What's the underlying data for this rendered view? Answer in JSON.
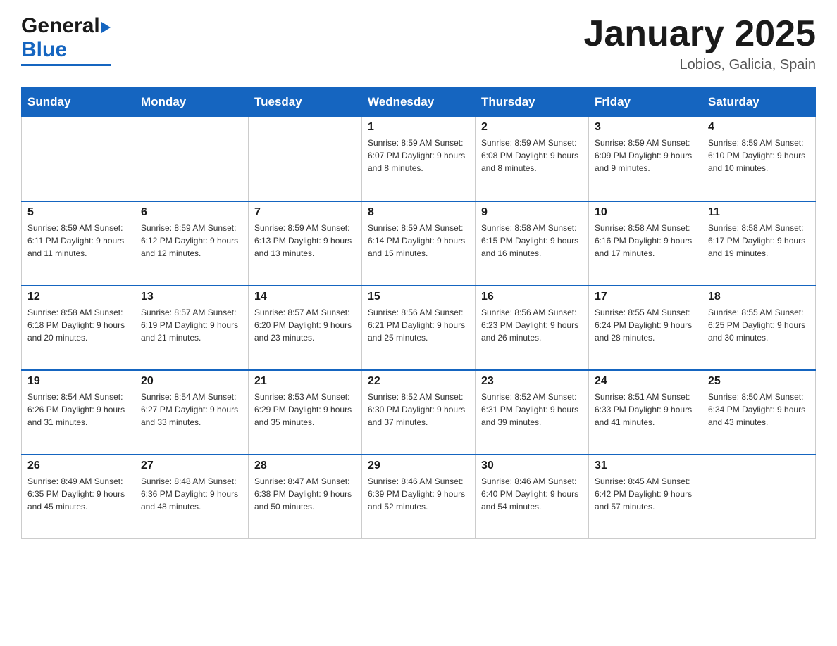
{
  "header": {
    "logo_general": "General",
    "logo_blue": "Blue",
    "month_title": "January 2025",
    "location": "Lobios, Galicia, Spain"
  },
  "days_of_week": [
    "Sunday",
    "Monday",
    "Tuesday",
    "Wednesday",
    "Thursday",
    "Friday",
    "Saturday"
  ],
  "weeks": [
    [
      {
        "day": "",
        "info": ""
      },
      {
        "day": "",
        "info": ""
      },
      {
        "day": "",
        "info": ""
      },
      {
        "day": "1",
        "info": "Sunrise: 8:59 AM\nSunset: 6:07 PM\nDaylight: 9 hours\nand 8 minutes."
      },
      {
        "day": "2",
        "info": "Sunrise: 8:59 AM\nSunset: 6:08 PM\nDaylight: 9 hours\nand 8 minutes."
      },
      {
        "day": "3",
        "info": "Sunrise: 8:59 AM\nSunset: 6:09 PM\nDaylight: 9 hours\nand 9 minutes."
      },
      {
        "day": "4",
        "info": "Sunrise: 8:59 AM\nSunset: 6:10 PM\nDaylight: 9 hours\nand 10 minutes."
      }
    ],
    [
      {
        "day": "5",
        "info": "Sunrise: 8:59 AM\nSunset: 6:11 PM\nDaylight: 9 hours\nand 11 minutes."
      },
      {
        "day": "6",
        "info": "Sunrise: 8:59 AM\nSunset: 6:12 PM\nDaylight: 9 hours\nand 12 minutes."
      },
      {
        "day": "7",
        "info": "Sunrise: 8:59 AM\nSunset: 6:13 PM\nDaylight: 9 hours\nand 13 minutes."
      },
      {
        "day": "8",
        "info": "Sunrise: 8:59 AM\nSunset: 6:14 PM\nDaylight: 9 hours\nand 15 minutes."
      },
      {
        "day": "9",
        "info": "Sunrise: 8:58 AM\nSunset: 6:15 PM\nDaylight: 9 hours\nand 16 minutes."
      },
      {
        "day": "10",
        "info": "Sunrise: 8:58 AM\nSunset: 6:16 PM\nDaylight: 9 hours\nand 17 minutes."
      },
      {
        "day": "11",
        "info": "Sunrise: 8:58 AM\nSunset: 6:17 PM\nDaylight: 9 hours\nand 19 minutes."
      }
    ],
    [
      {
        "day": "12",
        "info": "Sunrise: 8:58 AM\nSunset: 6:18 PM\nDaylight: 9 hours\nand 20 minutes."
      },
      {
        "day": "13",
        "info": "Sunrise: 8:57 AM\nSunset: 6:19 PM\nDaylight: 9 hours\nand 21 minutes."
      },
      {
        "day": "14",
        "info": "Sunrise: 8:57 AM\nSunset: 6:20 PM\nDaylight: 9 hours\nand 23 minutes."
      },
      {
        "day": "15",
        "info": "Sunrise: 8:56 AM\nSunset: 6:21 PM\nDaylight: 9 hours\nand 25 minutes."
      },
      {
        "day": "16",
        "info": "Sunrise: 8:56 AM\nSunset: 6:23 PM\nDaylight: 9 hours\nand 26 minutes."
      },
      {
        "day": "17",
        "info": "Sunrise: 8:55 AM\nSunset: 6:24 PM\nDaylight: 9 hours\nand 28 minutes."
      },
      {
        "day": "18",
        "info": "Sunrise: 8:55 AM\nSunset: 6:25 PM\nDaylight: 9 hours\nand 30 minutes."
      }
    ],
    [
      {
        "day": "19",
        "info": "Sunrise: 8:54 AM\nSunset: 6:26 PM\nDaylight: 9 hours\nand 31 minutes."
      },
      {
        "day": "20",
        "info": "Sunrise: 8:54 AM\nSunset: 6:27 PM\nDaylight: 9 hours\nand 33 minutes."
      },
      {
        "day": "21",
        "info": "Sunrise: 8:53 AM\nSunset: 6:29 PM\nDaylight: 9 hours\nand 35 minutes."
      },
      {
        "day": "22",
        "info": "Sunrise: 8:52 AM\nSunset: 6:30 PM\nDaylight: 9 hours\nand 37 minutes."
      },
      {
        "day": "23",
        "info": "Sunrise: 8:52 AM\nSunset: 6:31 PM\nDaylight: 9 hours\nand 39 minutes."
      },
      {
        "day": "24",
        "info": "Sunrise: 8:51 AM\nSunset: 6:33 PM\nDaylight: 9 hours\nand 41 minutes."
      },
      {
        "day": "25",
        "info": "Sunrise: 8:50 AM\nSunset: 6:34 PM\nDaylight: 9 hours\nand 43 minutes."
      }
    ],
    [
      {
        "day": "26",
        "info": "Sunrise: 8:49 AM\nSunset: 6:35 PM\nDaylight: 9 hours\nand 45 minutes."
      },
      {
        "day": "27",
        "info": "Sunrise: 8:48 AM\nSunset: 6:36 PM\nDaylight: 9 hours\nand 48 minutes."
      },
      {
        "day": "28",
        "info": "Sunrise: 8:47 AM\nSunset: 6:38 PM\nDaylight: 9 hours\nand 50 minutes."
      },
      {
        "day": "29",
        "info": "Sunrise: 8:46 AM\nSunset: 6:39 PM\nDaylight: 9 hours\nand 52 minutes."
      },
      {
        "day": "30",
        "info": "Sunrise: 8:46 AM\nSunset: 6:40 PM\nDaylight: 9 hours\nand 54 minutes."
      },
      {
        "day": "31",
        "info": "Sunrise: 8:45 AM\nSunset: 6:42 PM\nDaylight: 9 hours\nand 57 minutes."
      },
      {
        "day": "",
        "info": ""
      }
    ]
  ]
}
